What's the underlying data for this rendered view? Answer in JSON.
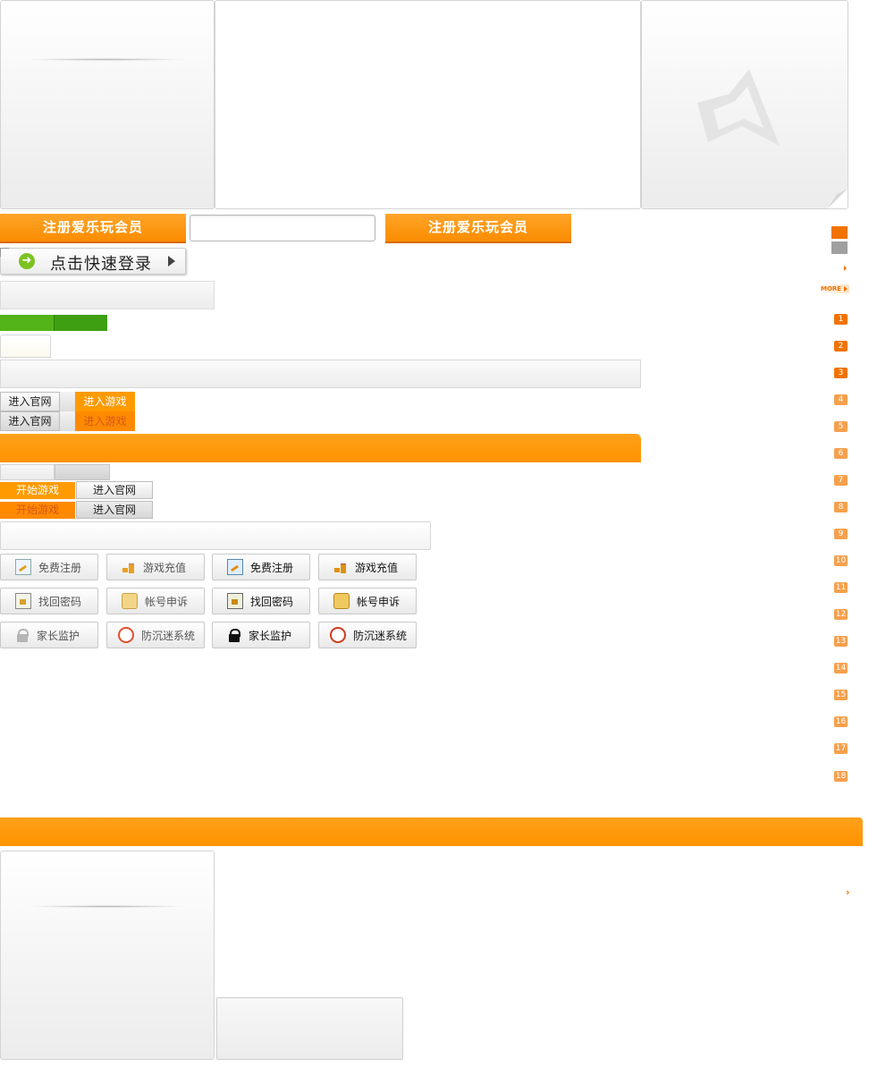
{
  "buttons": {
    "register_label": "注册爱乐玩会员",
    "register_label_2": "注册爱乐玩会员",
    "quick_login_label": "点击快速登录",
    "enter_site": "进入官网",
    "enter_game": "进入游戏",
    "start_game": "开始游戏"
  },
  "icon_buttons": {
    "free_register": "免费注册",
    "recharge": "游戏充值",
    "find_password": "找回密码",
    "account_appeal": "帐号申诉",
    "parental": "家长监护",
    "anti_addiction": "防沉迷系统"
  },
  "right_column": {
    "more_label": "MORE",
    "numbers": [
      "1",
      "2",
      "3",
      "4",
      "5",
      "6",
      "7",
      "8",
      "9",
      "10",
      "11",
      "12",
      "13",
      "14",
      "15",
      "16",
      "17",
      "18"
    ]
  },
  "colors": {
    "accent": "#ff9a00",
    "accent_dark": "#f07300",
    "green": "#3e9f12"
  }
}
